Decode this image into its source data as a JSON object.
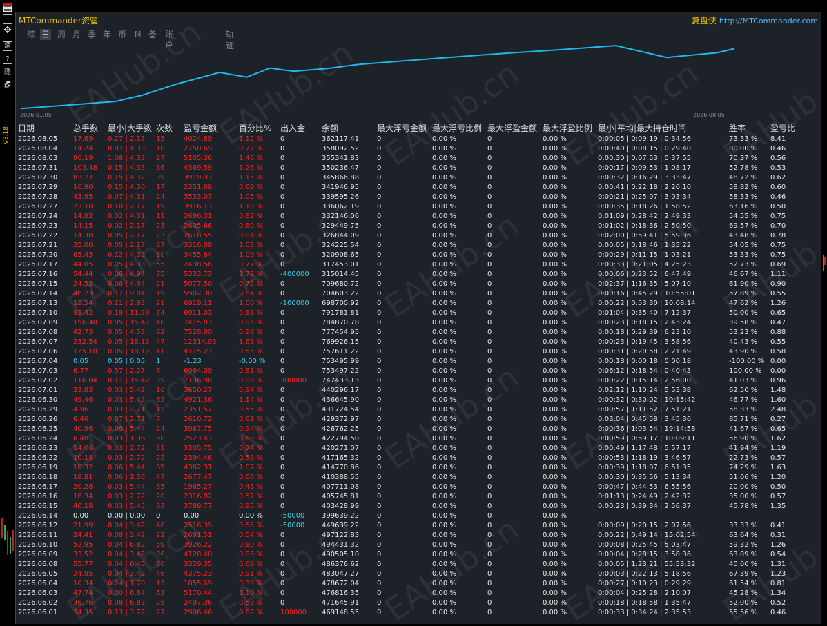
{
  "app": {
    "title": "MTCommander资管",
    "brand": "复盘侠",
    "url": "http://MTCommander.com",
    "version": "V8.18"
  },
  "tabs": [
    {
      "label": "综",
      "active": false
    },
    {
      "label": "日",
      "active": true
    },
    {
      "label": "周",
      "active": false
    },
    {
      "label": "月",
      "active": false
    },
    {
      "label": "季",
      "active": false
    },
    {
      "label": "年",
      "active": false
    },
    {
      "label": "币",
      "active": false
    },
    {
      "label": "M",
      "active": false
    },
    {
      "label": "备",
      "active": false
    },
    {
      "label": "账户",
      "active": false
    },
    {
      "label": "轨迹",
      "active": false
    }
  ],
  "sidebar_buttons": [
    {
      "icon": "grid-icon"
    },
    {
      "icon": "minimize-icon",
      "label": "–"
    },
    {
      "icon": "move-icon",
      "label": "✥"
    },
    {
      "icon": "clear-icon",
      "label": "清"
    },
    {
      "icon": "help-icon",
      "label": "?"
    },
    {
      "icon": "hide-icon",
      "label": "隱"
    },
    {
      "icon": "restore-icon",
      "label": "🗗"
    }
  ],
  "watermark": "EAHub.cn",
  "chart_data": {
    "type": "line",
    "x_start_label": "2026.01.05",
    "x_end_label": "2026.08.05",
    "x": [
      "2026.01.05",
      "2026.02.02",
      "2026.02.10",
      "2026.02.20",
      "2026.02.27",
      "2026.03.05",
      "2026.03.13",
      "2026.03.20",
      "2026.03.27",
      "2026.04.06",
      "2026.04.15",
      "2026.04.27",
      "2026.05.12",
      "2026.05.28",
      "2026.06.15",
      "2026.07.01",
      "2026.07.16",
      "2026.07.31",
      "2026.08.05"
    ],
    "values": [
      210000,
      228000,
      244000,
      272000,
      288000,
      302000,
      290000,
      313000,
      305000,
      312000,
      322000,
      330000,
      340000,
      350000,
      360000,
      370000,
      340000,
      352000,
      362117.41
    ],
    "axes_visible": false,
    "color": "#1fb8f0"
  },
  "table": {
    "columns": [
      "日期",
      "总手数",
      "最小|大手数",
      "次数",
      "盈亏金额",
      "百分比%",
      "出入金",
      "余额",
      "最大浮亏金额",
      "最大浮亏比例",
      "最大浮盈金额",
      "最大浮盈比例",
      "最小|平均|最大持仓时间",
      "胜率",
      "盈亏比"
    ],
    "rows": [
      [
        "2026.08.05",
        "17.69",
        "0.27 | 2.17",
        "15",
        "4024.89",
        "1.12 %",
        "0",
        "362117.41",
        "0",
        "0.00 %",
        "0",
        "0.00 %",
        "0:00:05 | 0:09:19 | 0:34:56",
        "73.33 %",
        "8.41"
      ],
      [
        "2026.08.04",
        "14.24",
        "0.07 | 4.33",
        "10",
        "2750.69",
        "0.77 %",
        "0",
        "358092.52",
        "0",
        "0.00 %",
        "0",
        "0.00 %",
        "0:00:40 | 0:08:15 | 0:29:40",
        "80.00 %",
        "0.46"
      ],
      [
        "2026.08.03",
        "96.19",
        "1.08 | 4.33",
        "27",
        "5105.36",
        "1.46 %",
        "0",
        "355341.83",
        "0",
        "0.00 %",
        "0",
        "0.00 %",
        "0:00:30 | 0:07:53 | 0:37:55",
        "70.37 %",
        "0.56"
      ],
      [
        "2026.07.31",
        "103.48",
        "0.15 | 4.33",
        "36",
        "4369.59",
        "1.26 %",
        "0",
        "350236.47",
        "0",
        "0.00 %",
        "0",
        "0.00 %",
        "0:00:17 | 0:09:53 | 1:08:17",
        "52.78 %",
        "0.53"
      ],
      [
        "2026.07.30",
        "83.27",
        "0.15 | 4.32",
        "39",
        "3919.93",
        "1.15 %",
        "0",
        "345866.88",
        "0",
        "0.00 %",
        "0",
        "0.00 %",
        "0:00:32 | 0:16:29 | 3:33:47",
        "48.72 %",
        "0.62"
      ],
      [
        "2026.07.29",
        "16.90",
        "0.15 | 4.30",
        "17",
        "2351.69",
        "0.69 %",
        "0",
        "341946.95",
        "0",
        "0.00 %",
        "0",
        "0.00 %",
        "0:00:41 | 0:22:18 | 2:20:10",
        "58.82 %",
        "0.60"
      ],
      [
        "2026.07.28",
        "43.95",
        "0.07 | 4.31",
        "24",
        "3533.07",
        "1.05 %",
        "0",
        "339595.26",
        "0",
        "0.00 %",
        "0",
        "0.00 %",
        "0:00:21 | 0:25:07 | 3:03:34",
        "58.33 %",
        "0.46"
      ],
      [
        "2026.07.27",
        "23.10",
        "0.10 | 2.17",
        "19",
        "3916.13",
        "1.18 %",
        "0",
        "336062.19",
        "0",
        "0.00 %",
        "0",
        "0.00 %",
        "0:00:35 | 0:18:26 | 1:58:52",
        "63.16 %",
        "0.50"
      ],
      [
        "2026.07.24",
        "14.82",
        "0.02 | 4.31",
        "11",
        "2696.31",
        "0.82 %",
        "0",
        "332146.06",
        "0",
        "0.00 %",
        "0",
        "0.00 %",
        "0:01:09 | 0:28:42 | 2:49:33",
        "54.55 %",
        "0.75"
      ],
      [
        "2026.07.23",
        "14.15",
        "0.02 | 2.17",
        "23",
        "2605.66",
        "0.80 %",
        "0",
        "329449.75",
        "0",
        "0.00 %",
        "0",
        "0.00 %",
        "0:01:02 | 0:18:36 | 2:50:50",
        "69.57 %",
        "0.70"
      ],
      [
        "2026.07.22",
        "14.38",
        "0.05 | 2.17",
        "23",
        "2618.55",
        "0.81 %",
        "0",
        "326844.09",
        "0",
        "0.00 %",
        "0",
        "0.00 %",
        "0:02:00 | 0:59:41 | 5:59:36",
        "43.48 %",
        "0.78"
      ],
      [
        "2026.07.21",
        "35.00",
        "0.05 | 2.17",
        "37",
        "3316.89",
        "1.03 %",
        "0",
        "324225.54",
        "0",
        "0.00 %",
        "0",
        "0.00 %",
        "0:00:05 | 0:18:46 | 1:35:22",
        "54.05 %",
        "0.75"
      ],
      [
        "2026.07.20",
        "65.43",
        "0.12 | 4.32",
        "30",
        "3455.64",
        "1.09 %",
        "0",
        "320908.65",
        "0",
        "0.00 %",
        "0",
        "0.00 %",
        "0:00:29 | 0:11:15 | 1:03:21",
        "53.33 %",
        "0.75"
      ],
      [
        "2026.07.17",
        "44.05",
        "0.05 | 4.33",
        "55",
        "2438.56",
        "0.77 %",
        "0",
        "317453.01",
        "0",
        "0.00 %",
        "0",
        "0.00 %",
        "0:00:33 | 0:21:05 | 4:25:23",
        "52.73 %",
        "0.69"
      ],
      [
        "2026.07.16",
        "54.44",
        "0.06 | 4.94",
        "75",
        "5333.73",
        "1.72 %",
        "-400000",
        "315014.45",
        "0",
        "0.00 %",
        "0",
        "0.00 %",
        "0:00:06 | 0:23:52 | 6:47:49",
        "46.67 %",
        "1.11"
      ],
      [
        "2026.07.15",
        "24.52",
        "0.06 | 4.94",
        "21",
        "5077.50",
        "0.72 %",
        "0",
        "709680.72",
        "0",
        "0.00 %",
        "0",
        "0.00 %",
        "0:02:37 | 1:16:35 | 5:07:10",
        "61.90 %",
        "0.90"
      ],
      [
        "2026.07.14",
        "48.23",
        "0.17 | 9.84",
        "19",
        "5902.30",
        "0.84 %",
        "0",
        "704603.22",
        "0",
        "0.00 %",
        "0",
        "0.00 %",
        "0:00:16 | 0:45:29 | 10:55:01",
        "57.89 %",
        "0.55"
      ],
      [
        "2026.07.13",
        "15.54",
        "0.11 | 2.83",
        "21",
        "6919.11",
        "1.00 %",
        "-100000",
        "698700.92",
        "0",
        "0.00 %",
        "0",
        "0.00 %",
        "0:00:22 | 0:53:30 | 10:08:14",
        "47.62 %",
        "1.26"
      ],
      [
        "2026.07.10",
        "93.42",
        "0.19 | 11.29",
        "34",
        "6911.03",
        "0.88 %",
        "0",
        "791781.81",
        "0",
        "0.00 %",
        "0",
        "0.00 %",
        "0:01:04 | 0:35:40 | 7:12:37",
        "50.00 %",
        "0.65"
      ],
      [
        "2026.07.09",
        "196.40",
        "0.05 | 15.47",
        "48",
        "7415.83",
        "0.95 %",
        "0",
        "784870.78",
        "0",
        "0.00 %",
        "0",
        "0.00 %",
        "0:00:23 | 0:18:15 | 2:43:24",
        "39.58 %",
        "0.47"
      ],
      [
        "2026.07.08",
        "42.73",
        "0.05 | 4.53",
        "62",
        "7528.80",
        "0.98 %",
        "0",
        "777454.95",
        "0",
        "0.00 %",
        "0",
        "0.00 %",
        "0:00:18 | 0:29:39 | 6:23:10",
        "53.23 %",
        "0.88"
      ],
      [
        "2026.07.07",
        "232.54",
        "0.05 | 18.13",
        "47",
        "12314.93",
        "1.63 %",
        "0",
        "769926.15",
        "0",
        "0.00 %",
        "0",
        "0.00 %",
        "0:00:23 | 0:19:45 | 3:58:56",
        "40.43 %",
        "0.55"
      ],
      [
        "2026.07.06",
        "125.10",
        "0.05 | 18.12",
        "41",
        "4115.23",
        "0.55 %",
        "0",
        "757611.22",
        "0",
        "0.00 %",
        "0",
        "0.00 %",
        "0:00:31 | 0:20:58 | 2:21:49",
        "43.90 %",
        "0.58"
      ],
      [
        "2026.07.04",
        "0.05",
        "0.05 | 0.05",
        "1",
        "-1.23",
        "-0.00 %",
        "0",
        "753495.99",
        "0",
        "0.00 %",
        "0",
        "0.00 %",
        "0:00:18 | 0:00:18 | 0:00:18",
        "-100.00 %",
        "0.00"
      ],
      [
        "2026.07.03",
        "6.77",
        "0.57 | 2.27",
        "6",
        "6064.09",
        "0.81 %",
        "0",
        "753497.22",
        "0",
        "0.00 %",
        "0",
        "0.00 %",
        "0:06:12 | 0:18:54 | 0:40:43",
        "100.00 %",
        "0.00"
      ],
      [
        "2026.07.02",
        "116.04",
        "0.11 | 15.42",
        "39",
        "7136.96",
        "0.96 %",
        "300000",
        "747433.13",
        "0",
        "0.00 %",
        "0",
        "0.00 %",
        "0:00:22 | 0:15:14 | 2:56:00",
        "41.03 %",
        "0.96"
      ],
      [
        "2026.07.01",
        "23.83",
        "0.03 | 5.42",
        "16",
        "3650.27",
        "0.84 %",
        "0",
        "440296.17",
        "0",
        "0.00 %",
        "0",
        "0.00 %",
        "0:02:12 | 1:10:24 | 5:53:38",
        "62.50 %",
        "1.48"
      ],
      [
        "2026.06.30",
        "49.46",
        "0.03 | 5.42",
        "62",
        "4921.36",
        "1.14 %",
        "0",
        "436645.90",
        "0",
        "0.00 %",
        "0",
        "0.00 %",
        "0:00:32 | 0:30:02 | 10:15:42",
        "46.77 %",
        "1.60"
      ],
      [
        "2026.06.29",
        "4.96",
        "0.03 | 2.71",
        "12",
        "2351.57",
        "0.55 %",
        "0",
        "431724.54",
        "0",
        "0.00 %",
        "0",
        "0.00 %",
        "0:00:57 | 1:11:52 | 7:51:21",
        "58.33 %",
        "2.48"
      ],
      [
        "2026.06.26",
        "6.46",
        "0.07 | 2.71",
        "7",
        "2610.72",
        "0.61 %",
        "0",
        "429372.97",
        "0",
        "0.00 %",
        "0",
        "0.00 %",
        "0:03:04 | 0:45:58 | 3:45:36",
        "85.71 %",
        "0.27"
      ],
      [
        "2026.06.25",
        "40.96",
        "0.06 | 5.44",
        "24",
        "3967.75",
        "0.94 %",
        "0",
        "426762.25",
        "0",
        "0.00 %",
        "0",
        "0.00 %",
        "0:00:36 | 1:03:54 | 19:14:58",
        "41.67 %",
        "0.65"
      ],
      [
        "2026.06.24",
        "6.48",
        "0.03 | 1.36",
        "58",
        "2523.43",
        "0.60 %",
        "0",
        "422794.50",
        "0",
        "0.00 %",
        "0",
        "0.00 %",
        "0:00:59 | 0:59:17 | 10:09:11",
        "56.90 %",
        "1.62"
      ],
      [
        "2026.06.23",
        "14.06",
        "0.03 | 2.72",
        "31",
        "3105.75",
        "0.74 %",
        "0",
        "420271.07",
        "0",
        "0.00 %",
        "0",
        "0.00 %",
        "0:00:49 | 1:17:48 | 5:57:17",
        "41.94 %",
        "1.19"
      ],
      [
        "2026.06.22",
        "10.18",
        "0.03 | 2.72",
        "22",
        "2394.46",
        "0.58 %",
        "0",
        "417165.32",
        "0",
        "0.00 %",
        "0",
        "0.00 %",
        "0:00:53 | 1:18:19 | 3:46:57",
        "22.73 %",
        "0.57"
      ],
      [
        "2026.06.19",
        "10.32",
        "0.06 | 5.44",
        "35",
        "4382.31",
        "1.07 %",
        "0",
        "414770.86",
        "0",
        "0.00 %",
        "0",
        "0.00 %",
        "0:00:39 | 1:18:07 | 6:51:35",
        "74.29 %",
        "1.63"
      ],
      [
        "2026.06.18",
        "18.81",
        "0.06 | 1.36",
        "47",
        "2677.47",
        "0.66 %",
        "0",
        "410388.55",
        "0",
        "0.00 %",
        "0",
        "0.00 %",
        "0:00:30 | 0:35:56 | 5:13:34",
        "51.06 %",
        "1.20"
      ],
      [
        "2026.06.17",
        "20.26",
        "0.03 | 5.44",
        "35",
        "1965.27",
        "0.48 %",
        "0",
        "407711.08",
        "0",
        "0.00 %",
        "0",
        "0.00 %",
        "0:00:47 | 0:44:53 | 6:55:56",
        "20.00 %",
        "0.50"
      ],
      [
        "2026.06.16",
        "16.34",
        "0.03 | 2.72",
        "20",
        "2316.82",
        "0.57 %",
        "0",
        "405745.81",
        "0",
        "0.00 %",
        "0",
        "0.00 %",
        "0:01:13 | 0:24:49 | 2:42:32",
        "35.00 %",
        "0.57"
      ],
      [
        "2026.06.15",
        "40.18",
        "0.03 | 5.45",
        "83",
        "3789.77",
        "0.95 %",
        "0",
        "403428.99",
        "0",
        "0.00 %",
        "0",
        "0.00 %",
        "0:00:23 | 0:39:34 | 2:56:37",
        "45.78 %",
        "1.35"
      ],
      [
        "2026.06.14",
        "0.00",
        "0.00 | 0.00",
        "0",
        "0.00",
        "0.00 %",
        "-50000",
        "399639.22",
        "0",
        "0.00 %",
        "0",
        "0.00 %",
        "",
        "",
        ""
      ],
      [
        "2026.06.12",
        "21.99",
        "0.04 | 3.42",
        "48",
        "2516.39",
        "0.56 %",
        "-50000",
        "449639.22",
        "0",
        "0.00 %",
        "0",
        "0.00 %",
        "0:00:09 | 0:20:15 | 2:07:56",
        "33.33 %",
        "0.41"
      ],
      [
        "2026.06.11",
        "24.41",
        "0.08 | 3.42",
        "22",
        "2691.51",
        "0.54 %",
        "0",
        "497122.83",
        "0",
        "0.00 %",
        "0",
        "0.00 %",
        "0:00:22 | 0:49:14 | 15:02:54",
        "63.64 %",
        "0.31"
      ],
      [
        "2026.06.10",
        "52.95",
        "0.04 | 6.82",
        "59",
        "3926.22",
        "0.80 %",
        "0",
        "494431.32",
        "0",
        "0.00 %",
        "0",
        "0.00 %",
        "0:00:08 | 0:25:45 | 5:03:47",
        "59.32 %",
        "1.26"
      ],
      [
        "2026.06.09",
        "33.52",
        "0.04 | 3.42",
        "36",
        "4128.48",
        "0.85 %",
        "0",
        "490505.10",
        "0",
        "0.00 %",
        "0",
        "0.00 %",
        "0:00:04 | 0:28:15 | 3:58:36",
        "63.89 %",
        "0.54"
      ],
      [
        "2026.06.08",
        "55.77",
        "0.04 | 6.45",
        "60",
        "3329.35",
        "0.69 %",
        "0",
        "486376.62",
        "0",
        "0.00 %",
        "0",
        "0.00 %",
        "0:00:05 | 1:23:21 | 55:53:32",
        "40.00 %",
        "1.31"
      ],
      [
        "2026.06.05",
        "24.95",
        "0.04 | 3.42",
        "46",
        "4375.23",
        "0.91 %",
        "0",
        "483047.27",
        "0",
        "0.00 %",
        "0",
        "0.00 %",
        "0:00:03 | 0:22:13 | 5:18:56",
        "67.39 %",
        "1.23"
      ],
      [
        "2026.06.04",
        "10.34",
        "0.24 | 1.70",
        "13",
        "1855.69",
        "0.39 %",
        "0",
        "478672.04",
        "0",
        "0.00 %",
        "0",
        "0.00 %",
        "0:00:27 | 0:10:23 | 0:29:29",
        "61.54 %",
        "0.81"
      ],
      [
        "2026.06.03",
        "47.74",
        "0.00 | 6.84",
        "53",
        "5170.44",
        "1.10 %",
        "0",
        "476816.35",
        "0",
        "0.00 %",
        "0",
        "0.00 %",
        "0:00:04 | 0:25:28 | 2:10:07",
        "45.28 %",
        "1.34"
      ],
      [
        "2026.06.02",
        "36.76",
        "0.08 | 6.83",
        "25",
        "2497.36",
        "0.53 %",
        "0",
        "471645.91",
        "0",
        "0.00 %",
        "0",
        "0.00 %",
        "0:00:18 | 0:18:58 | 1:35:47",
        "52.00 %",
        "0.52"
      ],
      [
        "2026.06.01",
        "34.35",
        "0.13 | 3.72",
        "27",
        "2906.46",
        "0.62 %",
        "100000",
        "469148.55",
        "0",
        "0.00 %",
        "0",
        "0.00 %",
        "0:00:33 | 0:34:24 | 2:35:53",
        "55.56 %",
        "0.46"
      ]
    ]
  }
}
